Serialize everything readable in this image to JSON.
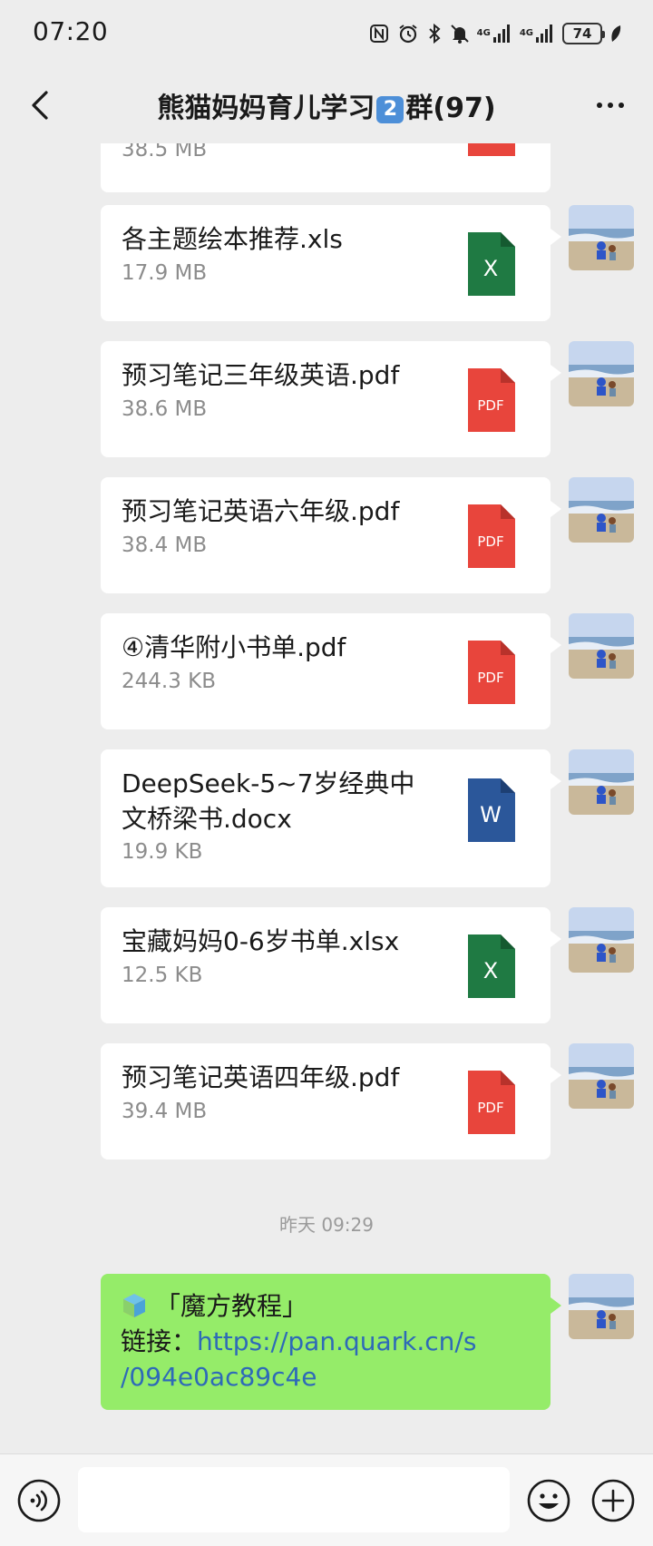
{
  "status_bar": {
    "time": "07:20",
    "network_label_1": "4G",
    "network_label_2": "4G",
    "battery": "74"
  },
  "header": {
    "title_prefix": "熊猫妈妈育儿学习",
    "title_badge": "2",
    "title_suffix": "群(97)",
    "back_icon": "chevron-left-icon",
    "more_icon": "more-dots-icon"
  },
  "messages": [
    {
      "type": "file",
      "name": "",
      "size": "38.5 MB",
      "file_type": "pdf",
      "partial": true
    },
    {
      "type": "file",
      "name": "各主题绘本推荐.xls",
      "size": "17.9 MB",
      "file_type": "xls",
      "icon_label": "X"
    },
    {
      "type": "file",
      "name": "预习笔记三年级英语.pdf",
      "size": "38.6 MB",
      "file_type": "pdf",
      "icon_label": "PDF"
    },
    {
      "type": "file",
      "name": "预习笔记英语六年级.pdf",
      "size": "38.4 MB",
      "file_type": "pdf",
      "icon_label": "PDF"
    },
    {
      "type": "file",
      "name": "④清华附小书单.pdf",
      "size": "244.3 KB",
      "file_type": "pdf",
      "icon_label": "PDF"
    },
    {
      "type": "file",
      "name": "DeepSeek-5~7岁经典中文桥梁书.docx",
      "size": "19.9 KB",
      "file_type": "docx",
      "icon_label": "W"
    },
    {
      "type": "file",
      "name": "宝藏妈妈0-6岁书单.xlsx",
      "size": "12.5 KB",
      "file_type": "xlsx",
      "icon_label": "X"
    },
    {
      "type": "file",
      "name": "预习笔记英语四年级.pdf",
      "size": "39.4 MB",
      "file_type": "pdf",
      "icon_label": "PDF"
    }
  ],
  "timestamp": "昨天 09:29",
  "text_message": {
    "line1": "「魔方教程」",
    "label": "链接：",
    "link_part1": "https://pan.quark.cn/s",
    "link_part2": "/094e0ac89c4e"
  },
  "colors": {
    "background": "#ededed",
    "bubble_white": "#ffffff",
    "bubble_green": "#95ec69",
    "pdf_red": "#e8453c",
    "excel_green": "#1f7a43",
    "word_blue": "#2b579a",
    "link": "#2e6ab8"
  },
  "input_bar": {
    "voice_icon": "voice-icon",
    "emoji_icon": "emoji-icon",
    "plus_icon": "plus-icon",
    "placeholder": ""
  }
}
